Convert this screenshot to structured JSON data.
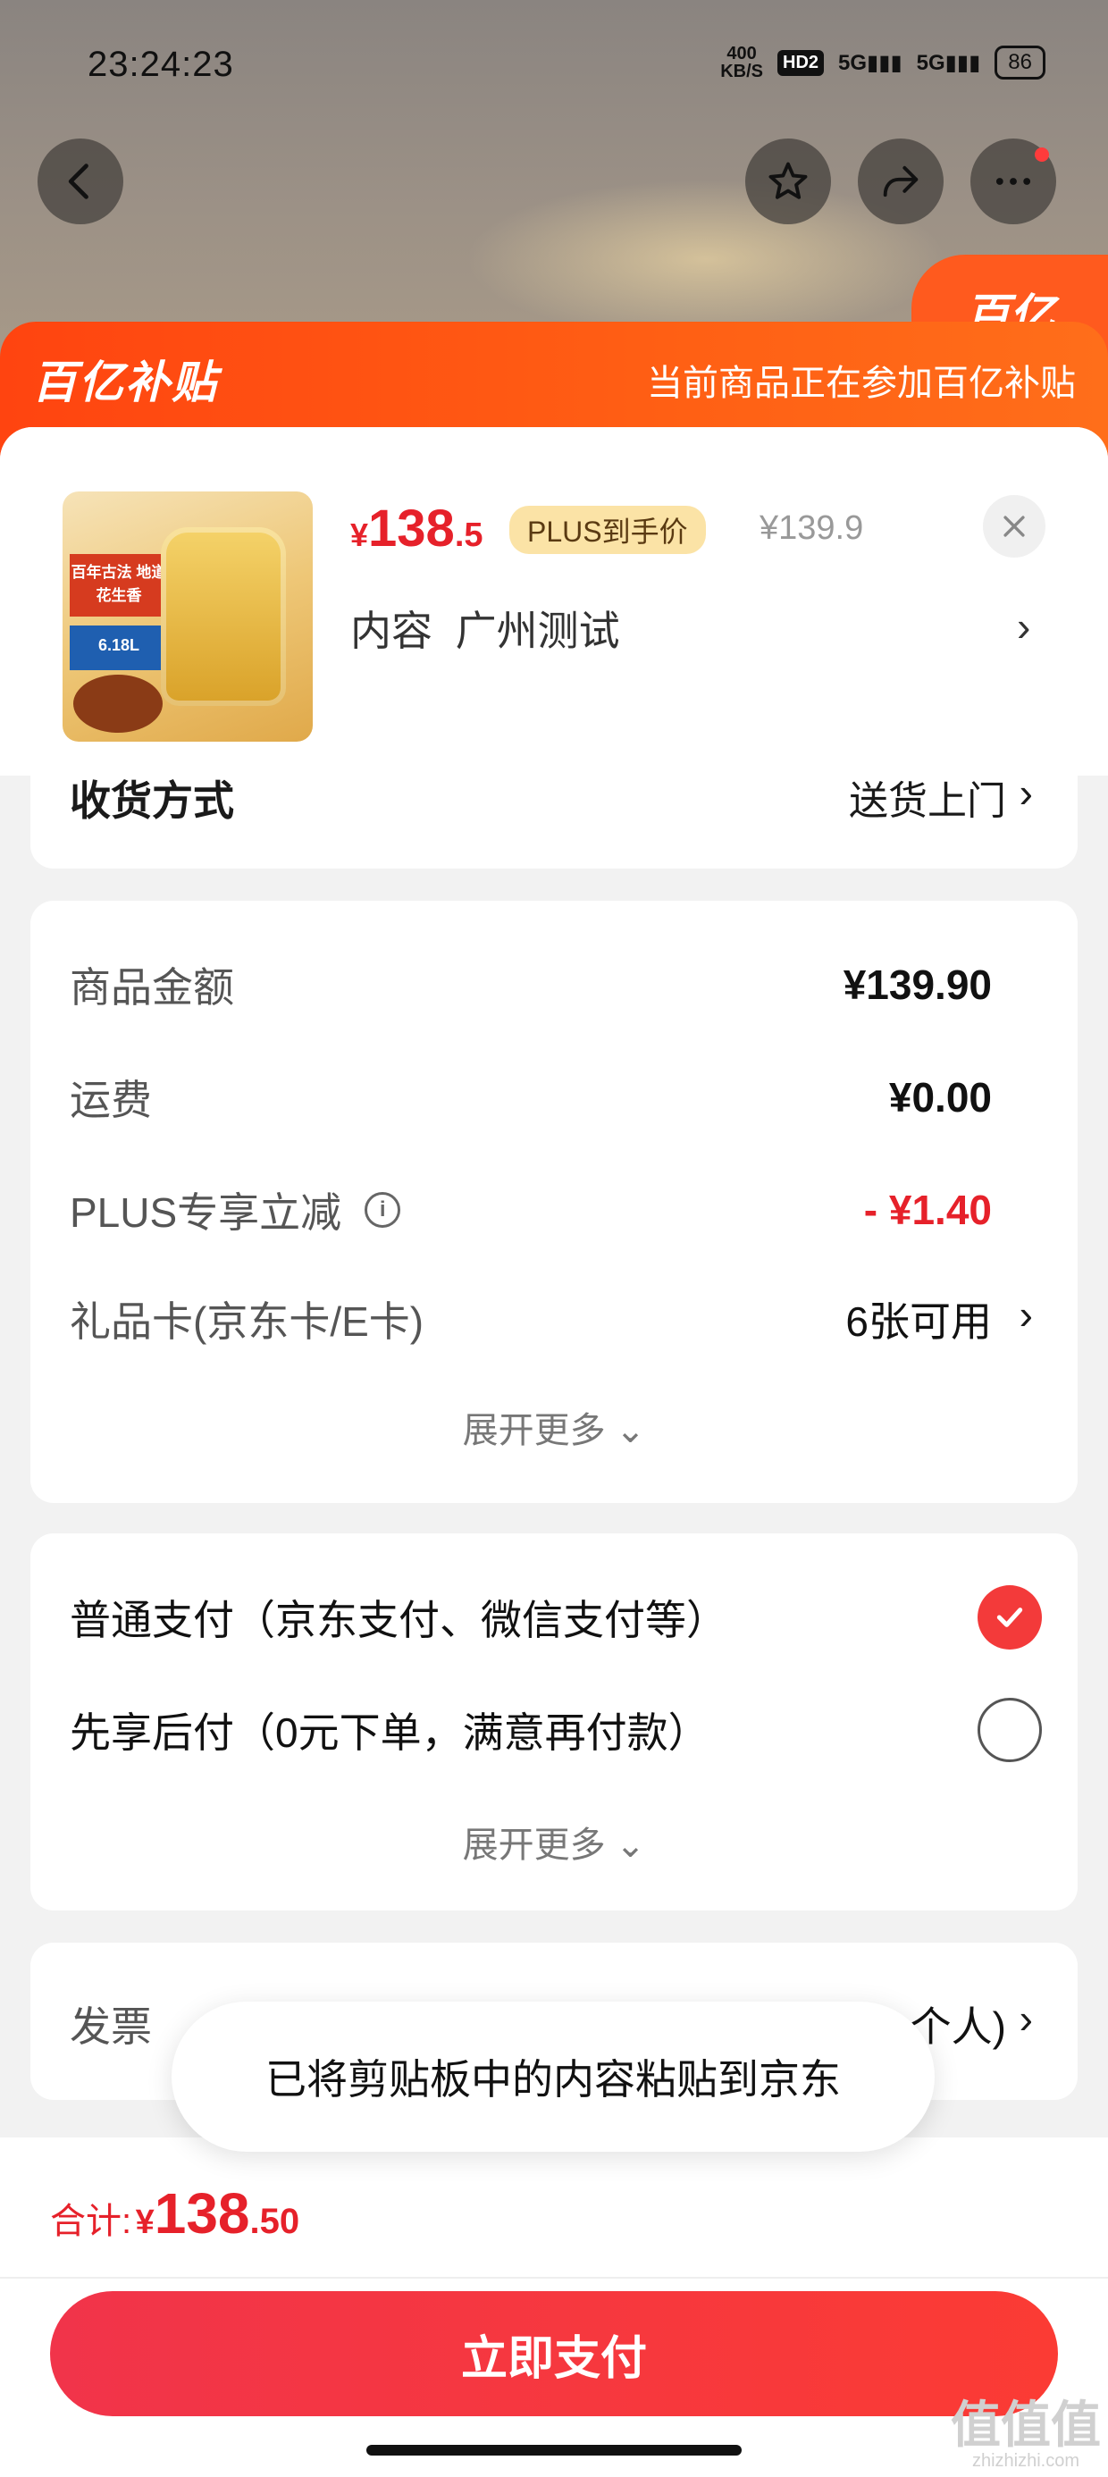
{
  "status_bar": {
    "time": "23:24:23",
    "speed_value": "400",
    "speed_unit": "KB/S",
    "hd": "HD2",
    "sig1": "5G",
    "sig2": "5G",
    "battery": "86"
  },
  "nav": {
    "back_icon": "chevron-left-icon",
    "fav_icon": "star-icon",
    "share_icon": "share-icon",
    "more_icon": "more-dots-icon"
  },
  "background": {
    "badge_text": "百亿"
  },
  "header": {
    "brand": "百亿补贴",
    "promo": "当前商品正在参加百亿补贴"
  },
  "product": {
    "price_currency": "¥",
    "price_int": "138",
    "price_dec": ".5",
    "plus_tag": "PLUS到手价",
    "original_price": "¥139.9",
    "spec_label": "内容",
    "spec_value": "广州测试",
    "thumb_tag1": "百年古法 地道花生香",
    "thumb_tag2": "6.18L"
  },
  "shipping": {
    "label": "收货方式",
    "value": "送货上门"
  },
  "fees": {
    "rows": [
      {
        "label": "商品金额",
        "value": "¥139.90"
      },
      {
        "label": "运费",
        "value": "¥0.00"
      },
      {
        "label": "PLUS专享立减",
        "value": "- ¥1.40"
      },
      {
        "label": "礼品卡(京东卡/E卡)",
        "value": "6张可用"
      }
    ],
    "expand": "展开更多"
  },
  "payment": {
    "options": [
      {
        "label": "普通支付（京东支付、微信支付等）",
        "selected": true
      },
      {
        "label": "先享后付（0元下单，满意再付款）",
        "selected": false
      }
    ],
    "expand": "展开更多"
  },
  "invoice": {
    "label": "发票",
    "value": "个人)"
  },
  "toast": "已将剪贴板中的内容粘贴到京东",
  "footer": {
    "total_label": "合计:",
    "total_currency": "¥",
    "total_int": "138",
    "total_dec": ".50",
    "pay_button": "立即支付",
    "watermark": "值值值",
    "watermark_sub": "zhizhizhi.com"
  },
  "colors": {
    "accent_red": "#e6212a",
    "brand_orange": "#ff4410",
    "pay_button": "#f1344a"
  }
}
